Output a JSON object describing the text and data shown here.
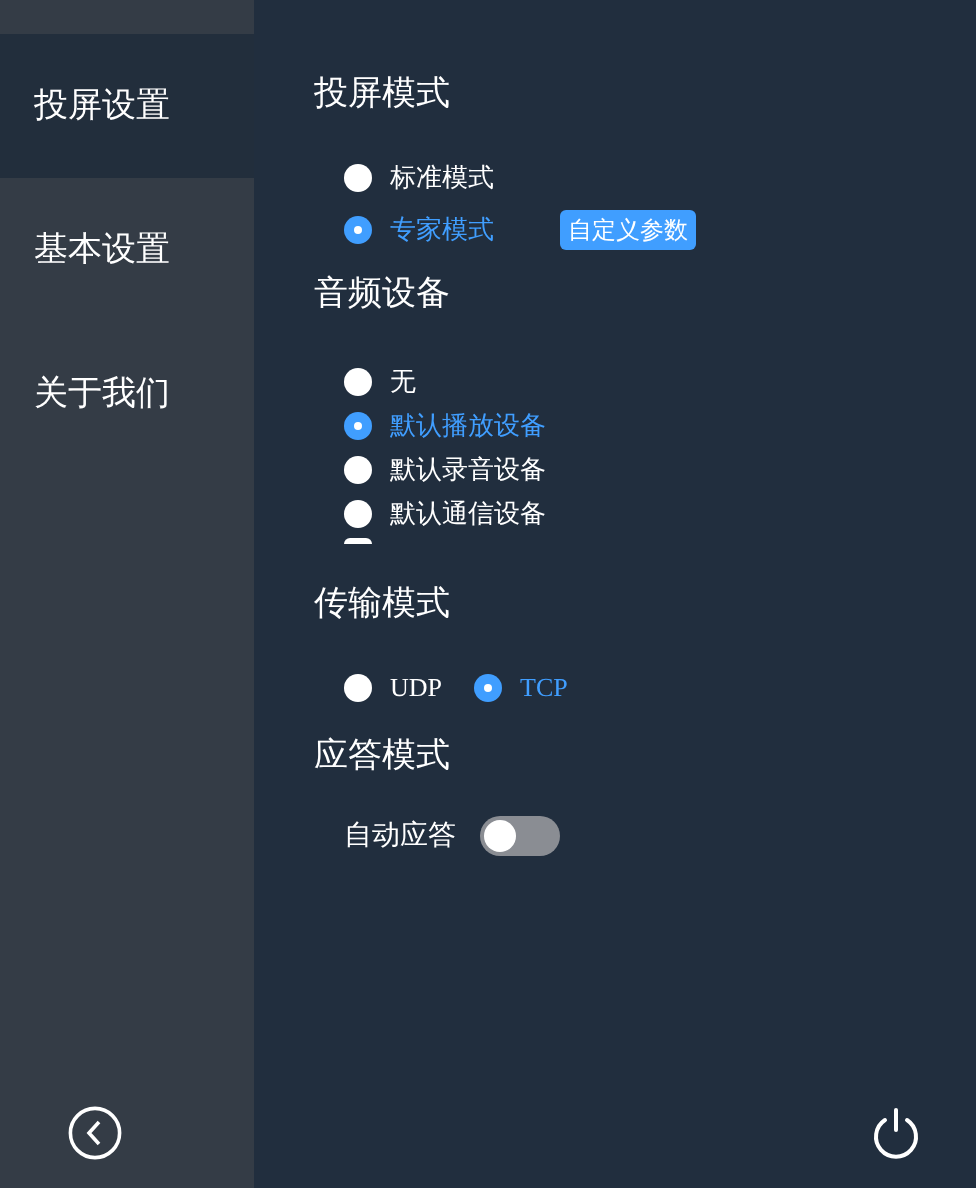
{
  "sidebar": {
    "items": [
      {
        "label": "投屏设置",
        "selected": true
      },
      {
        "label": "基本设置",
        "selected": false
      },
      {
        "label": "关于我们",
        "selected": false
      }
    ]
  },
  "sections": [
    {
      "title": "投屏模式",
      "kind": "radios",
      "options": [
        {
          "label": "标准模式",
          "selected": false
        },
        {
          "label": "专家模式",
          "selected": true,
          "button": "自定义参数"
        }
      ]
    },
    {
      "title": "音频设备",
      "kind": "scroll-radios",
      "options": [
        {
          "label": "无",
          "selected": false
        },
        {
          "label": "默认播放设备",
          "selected": true
        },
        {
          "label": "默认录音设备",
          "selected": false
        },
        {
          "label": "默认通信设备",
          "selected": false
        }
      ],
      "cut_option": {
        "selected": false
      }
    },
    {
      "title": "传输模式",
      "kind": "inline-radios",
      "options": [
        {
          "label": "UDP",
          "selected": false
        },
        {
          "label": "TCP",
          "selected": true
        }
      ]
    },
    {
      "title": "应答模式",
      "kind": "toggle",
      "label": "自动应答",
      "on": false
    }
  ]
}
